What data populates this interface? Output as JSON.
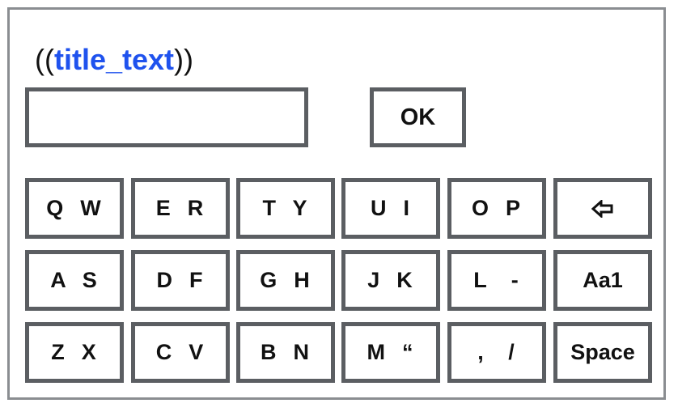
{
  "title": {
    "open": "((",
    "variable": "title_text",
    "close": "))"
  },
  "input": {
    "value": ""
  },
  "ok_label": "OK",
  "keyboard": {
    "rows": [
      [
        {
          "label": "Q  W"
        },
        {
          "label": "E  R"
        },
        {
          "label": "T  Y"
        },
        {
          "label": "U  I"
        },
        {
          "label": "O  P"
        },
        {
          "label": "",
          "icon": "backspace-arrow-icon"
        }
      ],
      [
        {
          "label": "A  S"
        },
        {
          "label": "D  F"
        },
        {
          "label": "G  H"
        },
        {
          "label": "J  K"
        },
        {
          "label": "L   -"
        },
        {
          "label": "Aa1"
        }
      ],
      [
        {
          "label": "Z  X"
        },
        {
          "label": "C  V"
        },
        {
          "label": "B  N"
        },
        {
          "label": "M  “"
        },
        {
          "label": ",   /"
        },
        {
          "label": "Space"
        }
      ]
    ]
  },
  "colors": {
    "frame_border": "#8a8d91",
    "key_border": "#5b5e62",
    "variable_text": "#1f52ee"
  }
}
